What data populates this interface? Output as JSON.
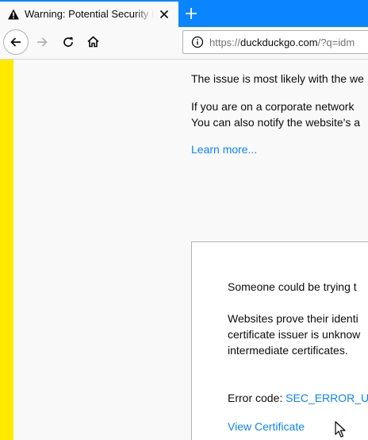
{
  "tab": {
    "title": "Warning: Potential Security Risk Ahead",
    "close_icon": "close-icon",
    "warning_icon": "warning-icon"
  },
  "newtab_icon": "plus-icon",
  "nav": {
    "back_icon": "back-arrow-icon",
    "forward_icon": "forward-arrow-icon",
    "reload_icon": "reload-icon",
    "home_icon": "home-icon"
  },
  "urlbar": {
    "scheme": "https://",
    "host": "duckduckgo.com",
    "path": "/?q=idm",
    "info_icon": "info-icon"
  },
  "colors": {
    "tabbar": "#0a84ff",
    "strip": "#ffe900",
    "link": "#0a84ff"
  },
  "content": {
    "line1": "The issue is most likely with the we",
    "line2": "If you are on a corporate network",
    "line3": "You can also notify the website's a",
    "learn_more": "Learn more...",
    "panel": {
      "line1": "Someone could be trying t",
      "line2": "Websites prove their identi",
      "line3": "certificate issuer is unknow",
      "line4": "intermediate certificates.",
      "error_label": "Error code:",
      "error_code": "SEC_ERROR_UN",
      "view_certificate": "View Certificate"
    }
  }
}
